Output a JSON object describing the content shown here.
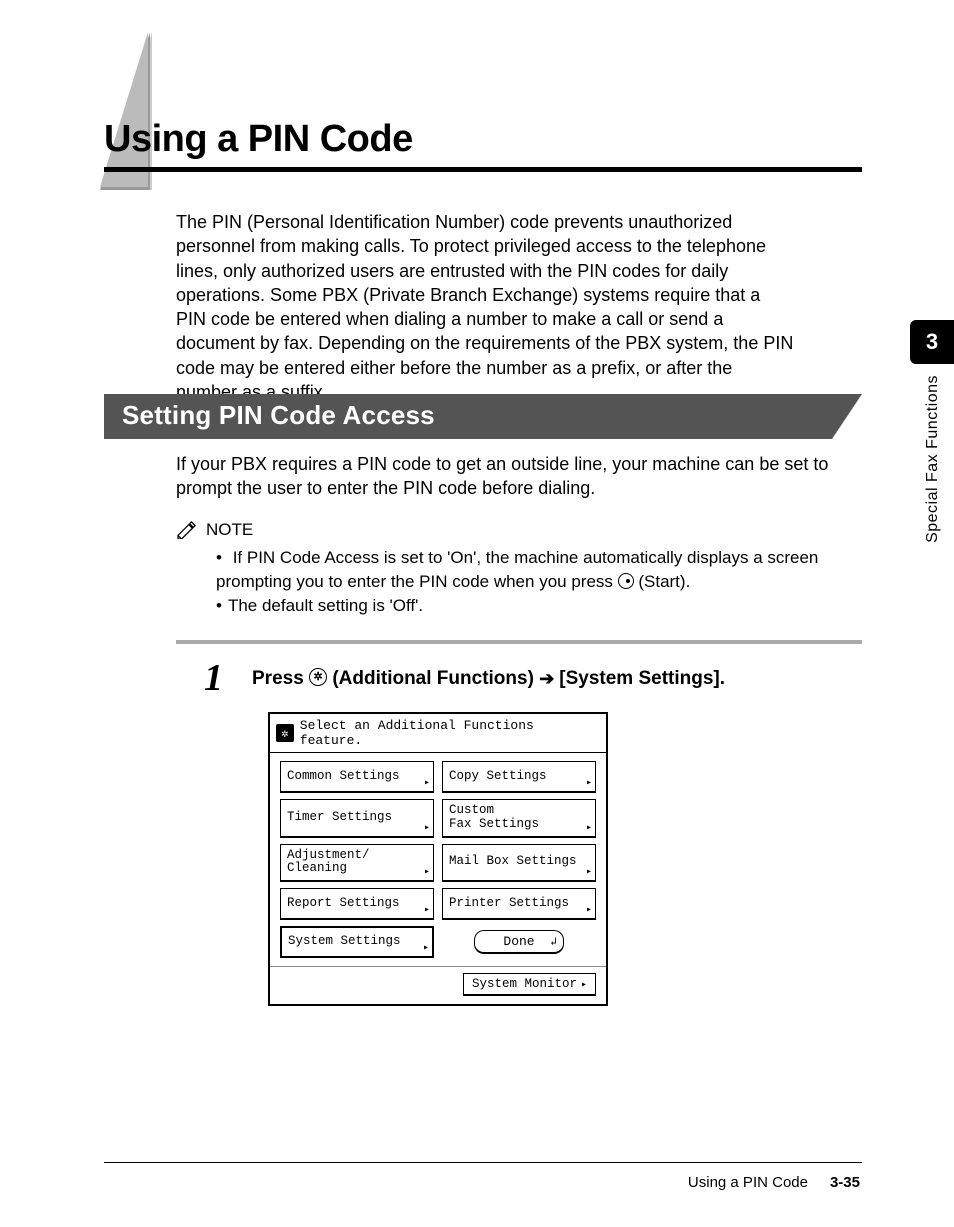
{
  "chapter": {
    "number": "3",
    "label": "Special Fax Functions"
  },
  "title": "Using a PIN Code",
  "intro": "The PIN (Personal Identification Number) code prevents unauthorized personnel from making calls. To protect privileged access to the telephone lines, only authorized users are entrusted with the PIN codes for daily operations. Some PBX (Private Branch Exchange) systems require that a PIN code be entered when dialing a number to make a call or send a document by fax. Depending on the requirements of the PBX system, the PIN code may be entered either before the number as a prefix, or after the number as a suffix.",
  "section": {
    "heading": "Setting PIN Code Access",
    "para": "If your PBX requires a PIN code to get an outside line, your machine can be set to prompt the user to enter the PIN code before dialing."
  },
  "note": {
    "label": "NOTE",
    "items": {
      "a_prefix": "If PIN Code Access is set to 'On', the machine automatically displays a screen prompting you to enter the PIN code when you press ",
      "a_suffix": " (Start).",
      "b": "The default setting is 'Off'."
    }
  },
  "step": {
    "number": "1",
    "prefix": "Press ",
    "mid": " (Additional Functions) ",
    "target": "[System Settings]."
  },
  "screen": {
    "header": "Select an Additional Functions feature.",
    "buttons": {
      "common": "Common Settings",
      "copy": "Copy Settings",
      "timer": "Timer Settings",
      "custom": "Custom\nFax Settings",
      "adjust": "Adjustment/\nCleaning",
      "mailbox": "Mail Box Settings",
      "report": "Report Settings",
      "printer": "Printer Settings",
      "system": "System Settings",
      "done": "Done",
      "sysmon": "System Monitor"
    }
  },
  "footer": {
    "title": "Using a PIN Code",
    "page": "3-35"
  }
}
